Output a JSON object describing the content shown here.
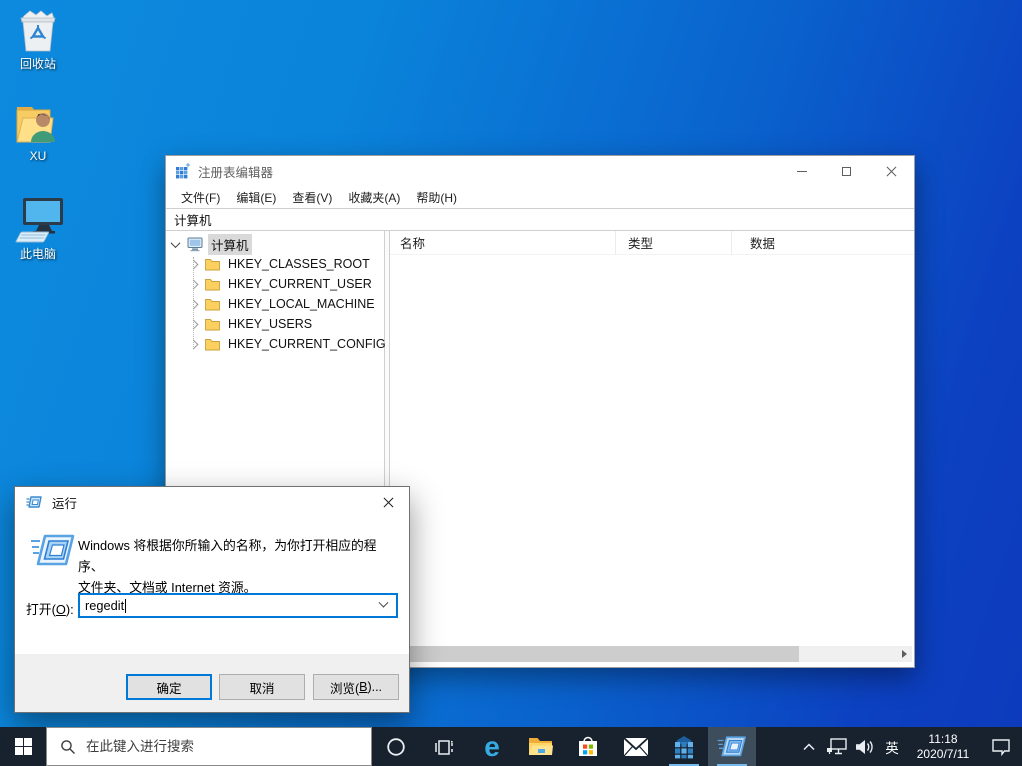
{
  "desktop": {
    "icons": [
      {
        "label": "回收站"
      },
      {
        "label": "XU"
      },
      {
        "label": "此电脑"
      }
    ]
  },
  "regedit_window": {
    "title": "注册表编辑器",
    "menu_items": [
      {
        "label": "文件(F)"
      },
      {
        "label": "编辑(E)"
      },
      {
        "label": "查看(V)"
      },
      {
        "label": "收藏夹(A)"
      },
      {
        "label": "帮助(H)"
      }
    ],
    "address": "计算机",
    "tree": {
      "root_label": "计算机",
      "keys": [
        {
          "label": "HKEY_CLASSES_ROOT"
        },
        {
          "label": "HKEY_CURRENT_USER"
        },
        {
          "label": "HKEY_LOCAL_MACHINE"
        },
        {
          "label": "HKEY_USERS"
        },
        {
          "label": "HKEY_CURRENT_CONFIG"
        }
      ]
    },
    "list_columns": [
      {
        "label": "名称"
      },
      {
        "label": "类型"
      },
      {
        "label": "数据"
      }
    ]
  },
  "run_dialog": {
    "title": "运行",
    "description": {
      "line1": "Windows 将根据你所输入的名称，为你打开相应的程序、",
      "line2": "文件夹、文档或 Internet 资源。"
    },
    "open_label": {
      "pre": "打开(",
      "key": "O",
      "post": "):"
    },
    "input_value": "regedit",
    "buttons": {
      "ok": "确定",
      "cancel": "取消",
      "browse_pre": "浏览(",
      "browse_key": "B",
      "browse_post": ")..."
    }
  },
  "taskbar": {
    "search": {
      "placeholder": "在此键入进行搜索"
    },
    "tray": {
      "language": "英",
      "time": "11:18",
      "date": "2020/7/11"
    }
  },
  "icons": {
    "edge": "e"
  },
  "colors": {
    "accent": "#0078d7",
    "taskbar_bg": "#17222e",
    "taskbar_active_tile": "#3e4d5b",
    "running_underline": "#76b9ed",
    "desktop_gradient_start": "#0d8ade",
    "desktop_gradient_end": "#0d3abc",
    "selection_inactive": "#d9d9d9",
    "folder_yellow": "#fcd05f"
  }
}
